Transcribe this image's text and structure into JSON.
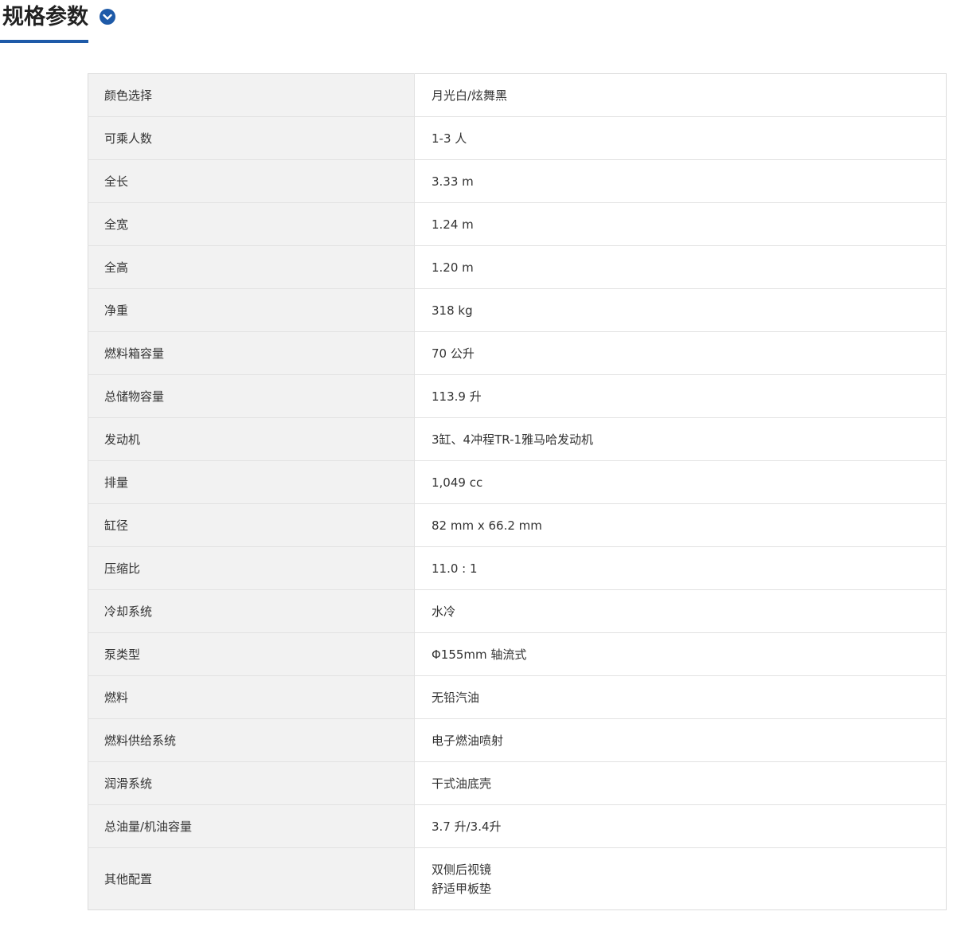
{
  "header": {
    "title": "规格参数",
    "toggle_icon": "chevron-down-circle-icon",
    "accent_color": "#1e5aa8"
  },
  "specs": [
    {
      "label": "颜色选择",
      "value": "月光白/炫舞黑"
    },
    {
      "label": "可乘人数",
      "value": "1-3 人"
    },
    {
      "label": "全长",
      "value": "3.33 m"
    },
    {
      "label": "全宽",
      "value": "1.24 m"
    },
    {
      "label": "全高",
      "value": "1.20 m"
    },
    {
      "label": "净重",
      "value": "318 kg"
    },
    {
      "label": "燃料箱容量",
      "value": "70 公升"
    },
    {
      "label": "总储物容量",
      "value": "113.9 升"
    },
    {
      "label": "发动机",
      "value": "3缸、4冲程TR-1雅马哈发动机"
    },
    {
      "label": "排量",
      "value": "1,049 cc"
    },
    {
      "label": "缸径",
      "value": "82 mm x 66.2 mm"
    },
    {
      "label": "压缩比",
      "value": "11.0 : 1"
    },
    {
      "label": "冷却系统",
      "value": "水冷"
    },
    {
      "label": "泵类型",
      "value": "Φ155mm 轴流式"
    },
    {
      "label": "燃料",
      "value": "无铅汽油"
    },
    {
      "label": "燃料供给系统",
      "value": "电子燃油喷射"
    },
    {
      "label": "润滑系统",
      "value": "干式油底壳"
    },
    {
      "label": "总油量/机油容量",
      "value": "3.7 升/3.4升"
    },
    {
      "label": "其他配置",
      "value_lines": [
        "双侧后视镜",
        "舒适甲板垫"
      ]
    }
  ]
}
